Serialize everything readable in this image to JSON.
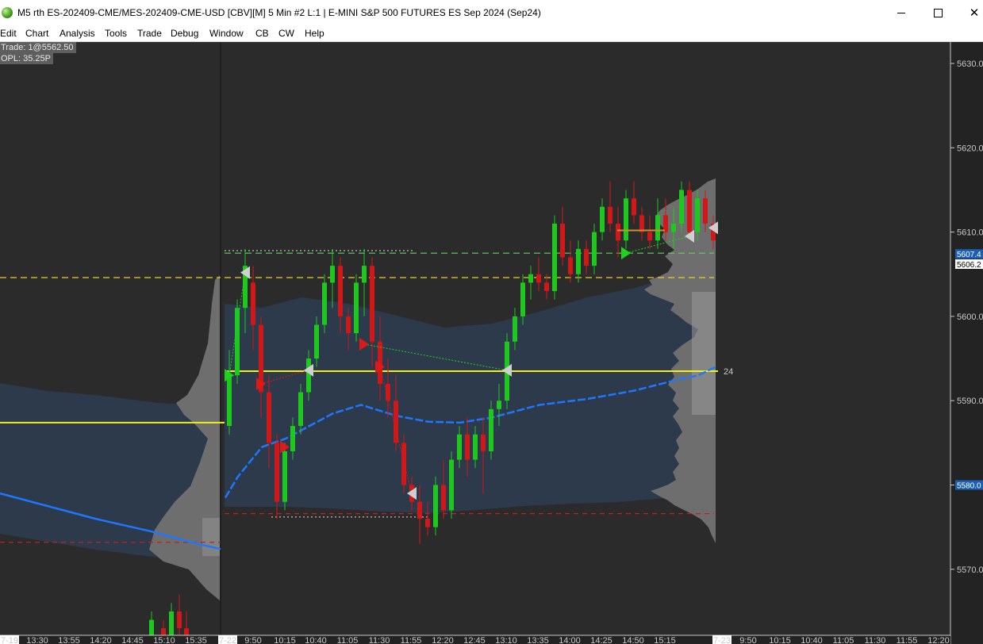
{
  "window": {
    "title": "M5 rth ES-202409-CME/MES-202409-CME-USD [CBV][M]  5 Min  #2 L:1 | E-MINI S&P 500 FUTURES ES Sep 2024 (Sep24)",
    "icon": "globe-icon"
  },
  "menu": [
    "Edit",
    "Chart",
    "Analysis",
    "Tools",
    "Trade",
    "Debug",
    "Window",
    "CB",
    "CW",
    "Help"
  ],
  "info": {
    "trade": "Trade: 1@5562.50",
    "opl": "OPL: 35.25P"
  },
  "colors": {
    "background": "#2b2b2b",
    "axis_background": "#232323",
    "bull_candle": "#1ec81e",
    "bear_candle": "#d01818",
    "vwap": "#1e78ff",
    "poc_line": "#f0f020",
    "value_area": "#2c3a4c",
    "tag_blue": "#1a5fb4"
  },
  "chart_data": {
    "type": "candlestick",
    "timeframe": "5 Min",
    "y_range": [
      5562,
      5632
    ],
    "y_ticks": [
      "5630.0",
      "5620.0",
      "5610.0",
      "5600.0",
      "5590.0",
      "5580.0",
      "5570.0"
    ],
    "x_labels": [
      "7-19",
      "13:30",
      "13:55",
      "14:20",
      "14:45",
      "15:10",
      "15:35",
      "7-22",
      "9:50",
      "10:15",
      "10:40",
      "11:05",
      "11:30",
      "11:55",
      "12:20",
      "12:45",
      "13:10",
      "13:35",
      "14:00",
      "14:25",
      "14:50",
      "15:15",
      "7-23",
      "9:50",
      "10:15",
      "10:40",
      "11:05",
      "11:30",
      "11:55",
      "12:20"
    ],
    "price_tags": [
      {
        "text": "5607.4",
        "price": 5607.4,
        "style": "blue"
      },
      {
        "text": "5606.2",
        "price": 5606.2,
        "style": "white"
      },
      {
        "text": "5580.0",
        "price": 5580.0,
        "style": "blue"
      }
    ],
    "poc_label": "24",
    "poc_price": 5593.5,
    "prev_poc_price": 5587.4,
    "levels": [
      {
        "price": 5607.5,
        "color": "#5fd35f",
        "dash": "8,5"
      },
      {
        "price": 5604.6,
        "color": "#e8d020",
        "dash": "8,5"
      },
      {
        "price": 5576.6,
        "color": "#c02020",
        "dash": "6,5"
      },
      {
        "price": 5573.2,
        "color": "#c02020",
        "dash": "6,5"
      }
    ],
    "candles": [
      [
        5587,
        5596,
        5586,
        5593
      ],
      [
        5593,
        5602,
        5592,
        5601
      ],
      [
        5601,
        5608,
        5598,
        5606
      ],
      [
        5604,
        5606,
        5596,
        5599
      ],
      [
        5599,
        5600,
        5588,
        5591
      ],
      [
        5591,
        5593,
        5582,
        5585
      ],
      [
        5585,
        5586,
        5576,
        5578
      ],
      [
        5578,
        5585,
        5577,
        5584
      ],
      [
        5584,
        5588,
        5583,
        5587
      ],
      [
        5587,
        5592,
        5586,
        5591
      ],
      [
        5591,
        5596,
        5590,
        5595
      ],
      [
        5595,
        5600,
        5594,
        5599
      ],
      [
        5599,
        5605,
        5598,
        5604
      ],
      [
        5604,
        5608,
        5601,
        5606
      ],
      [
        5606,
        5607,
        5598,
        5600
      ],
      [
        5600,
        5601,
        5596,
        5598
      ],
      [
        5598,
        5605,
        5597,
        5604
      ],
      [
        5604,
        5608,
        5600,
        5606
      ],
      [
        5606,
        5607,
        5594,
        5597
      ],
      [
        5597,
        5600,
        5590,
        5592
      ],
      [
        5592,
        5595,
        5588,
        5590
      ],
      [
        5590,
        5593,
        5584,
        5585
      ],
      [
        5585,
        5586,
        5579,
        5580
      ],
      [
        5580,
        5581,
        5577,
        5578
      ],
      [
        5578,
        5580,
        5573,
        5576
      ],
      [
        5576,
        5578,
        5574,
        5575
      ],
      [
        5575,
        5581,
        5574,
        5580
      ],
      [
        5580,
        5583,
        5576,
        5577
      ],
      [
        5577,
        5584,
        5576,
        5583
      ],
      [
        5583,
        5587,
        5582,
        5586
      ],
      [
        5586,
        5588,
        5581,
        5583
      ],
      [
        5583,
        5587,
        5582,
        5586
      ],
      [
        5586,
        5588,
        5579,
        5584
      ],
      [
        5584,
        5590,
        5583,
        5589
      ],
      [
        5589,
        5592,
        5587,
        5590
      ],
      [
        5590,
        5598,
        5589,
        5597
      ],
      [
        5597,
        5601,
        5596,
        5600
      ],
      [
        5600,
        5605,
        5599,
        5604
      ],
      [
        5604,
        5606,
        5602,
        5605
      ],
      [
        5605,
        5607,
        5603,
        5604
      ],
      [
        5604,
        5605,
        5602,
        5603
      ],
      [
        5603,
        5612,
        5602,
        5611
      ],
      [
        5611,
        5613,
        5606,
        5607
      ],
      [
        5607,
        5609,
        5604,
        5605
      ],
      [
        5605,
        5609,
        5604,
        5608
      ],
      [
        5608,
        5609,
        5605,
        5606
      ],
      [
        5606,
        5611,
        5605,
        5610
      ],
      [
        5610,
        5614,
        5609,
        5613
      ],
      [
        5613,
        5616,
        5610,
        5611
      ],
      [
        5611,
        5613,
        5607,
        5609
      ],
      [
        5609,
        5615,
        5608,
        5614
      ],
      [
        5614,
        5616,
        5611,
        5612
      ],
      [
        5612,
        5613,
        5609,
        5610
      ],
      [
        5610,
        5612,
        5608,
        5609
      ],
      [
        5609,
        5614,
        5608,
        5612
      ],
      [
        5612,
        5614,
        5609,
        5610
      ],
      [
        5610,
        5613,
        5608,
        5611
      ],
      [
        5611,
        5616,
        5610,
        5615
      ],
      [
        5615,
        5616,
        5609,
        5610
      ],
      [
        5610,
        5615,
        5609,
        5614
      ],
      [
        5614,
        5615,
        5610,
        5611
      ],
      [
        5611,
        5612,
        5608,
        5609
      ]
    ],
    "arrows": [
      {
        "i": 0,
        "price": 5593.0,
        "dir": "right",
        "color": "#1ed21e"
      },
      {
        "i": 2,
        "price": 5605.2,
        "dir": "left",
        "color": "#cfcfcf"
      },
      {
        "i": 4,
        "price": 5592.0,
        "dir": "right",
        "color": "#e01818"
      },
      {
        "i": 7,
        "price": 5584.5,
        "dir": "right",
        "color": "#e01818"
      },
      {
        "i": 10,
        "price": 5593.6,
        "dir": "left",
        "color": "#cfcfcf"
      },
      {
        "i": 17,
        "price": 5596.7,
        "dir": "right",
        "color": "#e01818"
      },
      {
        "i": 19,
        "price": 5594.0,
        "dir": "right",
        "color": "#e01818"
      },
      {
        "i": 23,
        "price": 5579.0,
        "dir": "left",
        "color": "#cfcfcf"
      },
      {
        "i": 35,
        "price": 5593.6,
        "dir": "left",
        "color": "#cfcfcf"
      },
      {
        "i": 50,
        "price": 5607.5,
        "dir": "right",
        "color": "#1ed21e"
      },
      {
        "i": 58,
        "price": 5609.5,
        "dir": "left",
        "color": "#cfcfcf"
      },
      {
        "i": 61,
        "price": 5610.5,
        "dir": "left",
        "color": "#cfcfcf"
      }
    ]
  }
}
